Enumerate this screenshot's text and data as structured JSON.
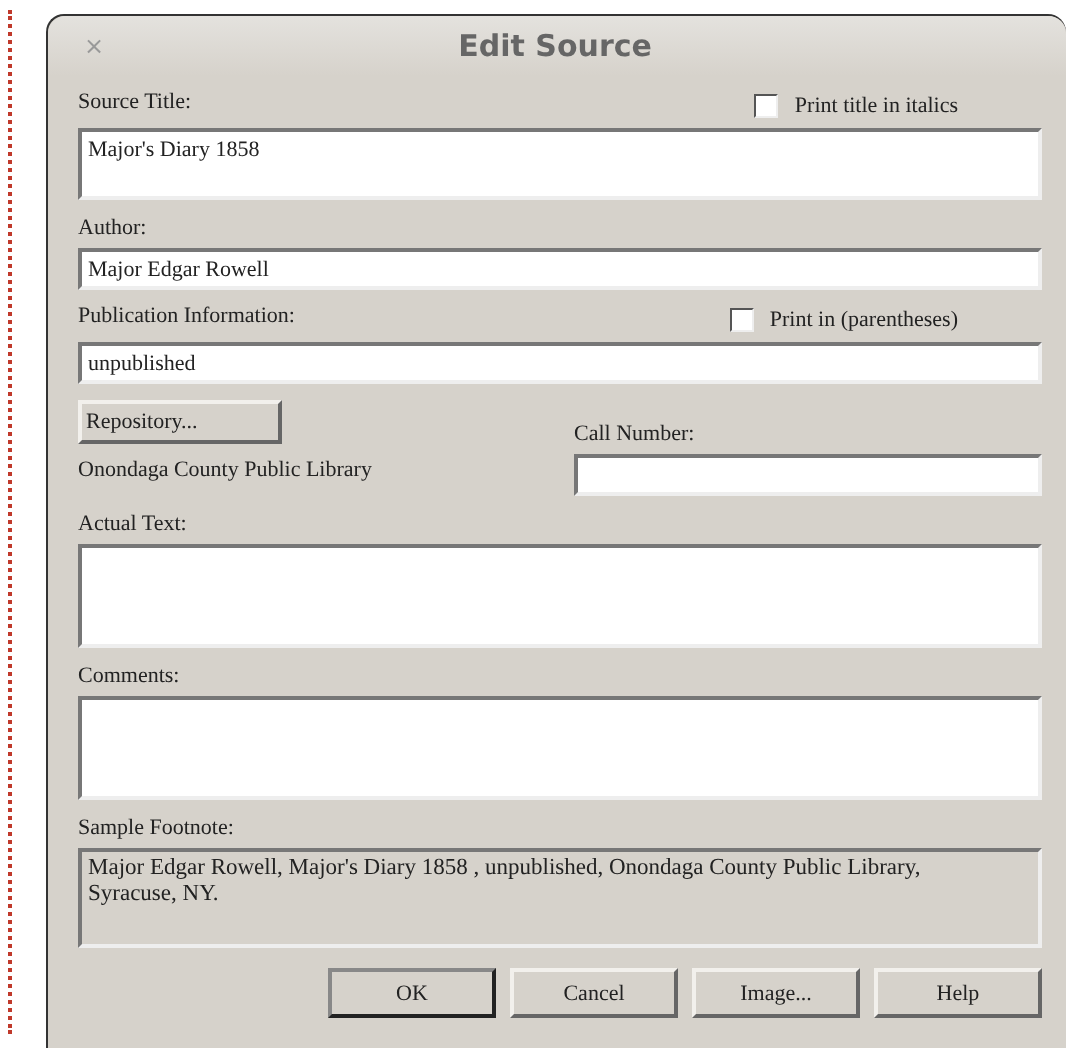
{
  "window": {
    "title": "Edit Source",
    "close": "×"
  },
  "source_title": {
    "label": "Source Title:",
    "value": "Major's Diary 1858"
  },
  "print_title_italics": {
    "label": "Print title in italics",
    "checked": false
  },
  "author": {
    "label": "Author:",
    "value": "Major Edgar Rowell"
  },
  "publication": {
    "label": "Publication Information:",
    "value": "unpublished"
  },
  "print_parentheses": {
    "label": "Print in (parentheses)",
    "checked": false
  },
  "repository_button": "Repository...",
  "repository_name": "Onondaga County Public Library",
  "call_number": {
    "label": "Call Number:"
  },
  "actual_text": {
    "label": "Actual Text:"
  },
  "comments": {
    "label": "Comments:"
  },
  "sample_footnote": {
    "label": "Sample Footnote:",
    "value": "Major Edgar Rowell, Major's Diary 1858 , unpublished, Onondaga County Public Library, Syracuse, NY."
  },
  "buttons": [
    {
      "label": "OK",
      "default": true
    },
    {
      "label": "Cancel",
      "default": false
    },
    {
      "label": "Image...",
      "default": false
    },
    {
      "label": "Help",
      "default": false
    }
  ]
}
